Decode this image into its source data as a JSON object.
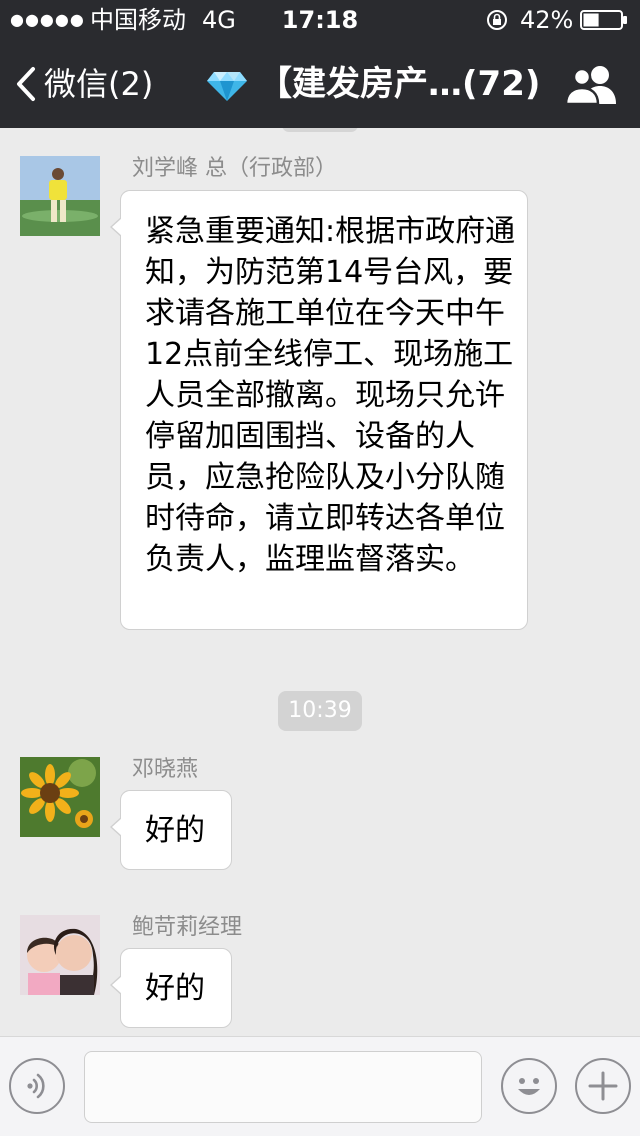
{
  "status_bar": {
    "signal": "●●●●●",
    "carrier": "中国移动",
    "network": "4G",
    "time": "17:18",
    "battery_percent": "42%",
    "battery_level": 0.42
  },
  "nav_bar": {
    "back_label": "微信(2)",
    "chat_title": "【建发房产…(72)"
  },
  "messages": [
    {
      "sender": "刘学峰 总（行政部）",
      "text": "紧急重要通知:根据市政府通知，为防范第14号台风，要求请各施工单位在今天中午12点前全线停工、现场施工人员全部撤离。现场只允许停留加固围挡、设备的人员，应急抢险队及小分队随时待命，请立即转达各单位负责人，监理监督落实。"
    },
    {
      "sender": "邓晓燕",
      "text": "好的"
    },
    {
      "sender": "鲍苛莉经理",
      "text": "好的"
    }
  ],
  "timestamp": "10:39",
  "input_bar": {
    "message_value": "",
    "icons": [
      "voice-icon",
      "emoji-icon",
      "plus-icon"
    ]
  },
  "colors": {
    "bar_background": "#2a2b2f",
    "chat_background": "#ebebeb",
    "bubble_background": "#ffffff",
    "timestamp_pill": "#d3d3d3"
  }
}
